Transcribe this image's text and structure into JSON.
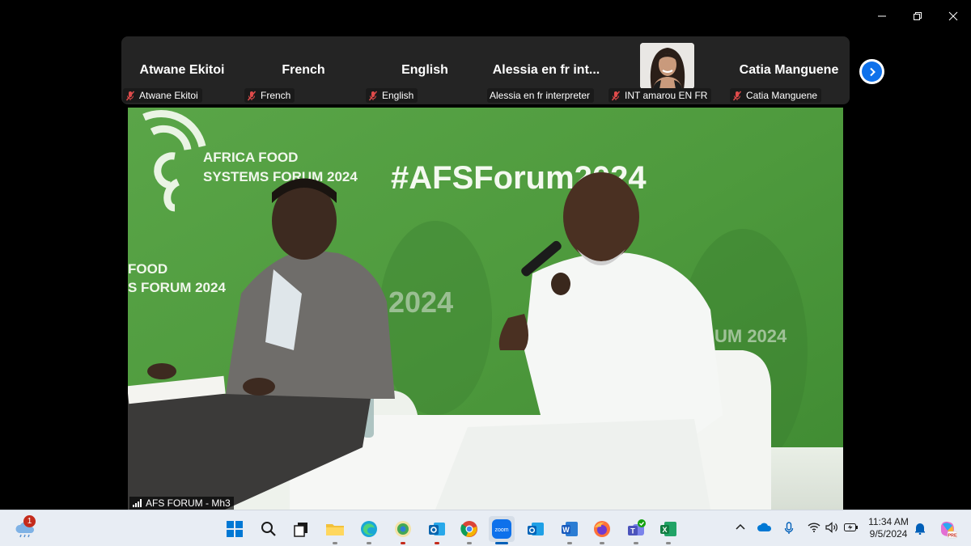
{
  "window": {
    "controls": [
      "minimize-icon",
      "restore-icon",
      "close-icon"
    ]
  },
  "participants": [
    {
      "display_name": "Atwane Ekitoi",
      "tag": "Atwane Ekitoi",
      "muted": true
    },
    {
      "display_name": "French",
      "tag": "French",
      "muted": true
    },
    {
      "display_name": "English",
      "tag": "English",
      "muted": true
    },
    {
      "display_name": "Alessia en fr int...",
      "tag": "Alessia en fr interpreter",
      "muted": false
    },
    {
      "display_name": "",
      "tag": "INT amarou EN FR",
      "muted": true,
      "has_video": true
    },
    {
      "display_name": "Catia Manguene",
      "tag": "Catia Manguene",
      "muted": true
    }
  ],
  "main_video": {
    "label": "AFS FORUM - Mh3",
    "signal_icon": "signal-bars-icon",
    "backdrop_text": {
      "logo_line1": "AFRICA FOOD",
      "logo_line2": "SYSTEMS FORUM 2024",
      "hashtag": "#AFSForum2024",
      "left_partial1": "FOOD",
      "left_partial2": "S FORUM 2024",
      "center_partial": "2024",
      "right_partial": "UM 2024"
    }
  },
  "taskbar": {
    "weather_badge": "1",
    "apps": [
      "start-icon",
      "search-icon",
      "task-view-icon",
      "file-explorer-icon",
      "edge-icon",
      "edge-canary-icon",
      "outlook-classic-icon",
      "chrome-icon",
      "zoom-icon",
      "outlook-new-icon",
      "word-icon",
      "firefox-icon",
      "teams-icon",
      "excel-icon"
    ],
    "zoom_label": "zoom",
    "time": "11:34 AM",
    "date": "9/5/2024",
    "colors": {
      "accent": "#005fb8",
      "zoom_blue": "#0e71eb",
      "muted_red": "#e04b4b",
      "stage_green": "#4b9a3c"
    }
  }
}
